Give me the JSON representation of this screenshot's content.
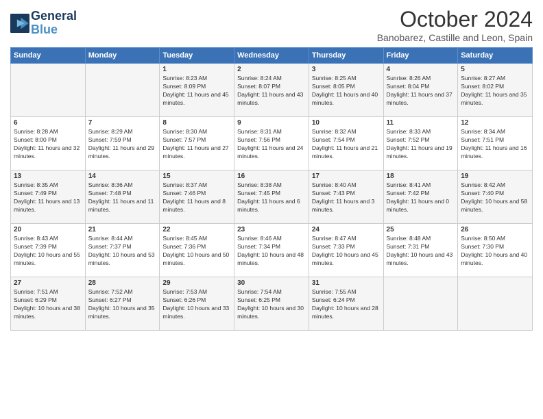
{
  "header": {
    "logo_line1": "General",
    "logo_line2": "Blue",
    "month": "October 2024",
    "location": "Banobarez, Castille and Leon, Spain"
  },
  "days_of_week": [
    "Sunday",
    "Monday",
    "Tuesday",
    "Wednesday",
    "Thursday",
    "Friday",
    "Saturday"
  ],
  "weeks": [
    [
      {
        "day": "",
        "content": ""
      },
      {
        "day": "",
        "content": ""
      },
      {
        "day": "1",
        "content": "Sunrise: 8:23 AM\nSunset: 8:09 PM\nDaylight: 11 hours and 45 minutes."
      },
      {
        "day": "2",
        "content": "Sunrise: 8:24 AM\nSunset: 8:07 PM\nDaylight: 11 hours and 43 minutes."
      },
      {
        "day": "3",
        "content": "Sunrise: 8:25 AM\nSunset: 8:05 PM\nDaylight: 11 hours and 40 minutes."
      },
      {
        "day": "4",
        "content": "Sunrise: 8:26 AM\nSunset: 8:04 PM\nDaylight: 11 hours and 37 minutes."
      },
      {
        "day": "5",
        "content": "Sunrise: 8:27 AM\nSunset: 8:02 PM\nDaylight: 11 hours and 35 minutes."
      }
    ],
    [
      {
        "day": "6",
        "content": "Sunrise: 8:28 AM\nSunset: 8:00 PM\nDaylight: 11 hours and 32 minutes."
      },
      {
        "day": "7",
        "content": "Sunrise: 8:29 AM\nSunset: 7:59 PM\nDaylight: 11 hours and 29 minutes."
      },
      {
        "day": "8",
        "content": "Sunrise: 8:30 AM\nSunset: 7:57 PM\nDaylight: 11 hours and 27 minutes."
      },
      {
        "day": "9",
        "content": "Sunrise: 8:31 AM\nSunset: 7:56 PM\nDaylight: 11 hours and 24 minutes."
      },
      {
        "day": "10",
        "content": "Sunrise: 8:32 AM\nSunset: 7:54 PM\nDaylight: 11 hours and 21 minutes."
      },
      {
        "day": "11",
        "content": "Sunrise: 8:33 AM\nSunset: 7:52 PM\nDaylight: 11 hours and 19 minutes."
      },
      {
        "day": "12",
        "content": "Sunrise: 8:34 AM\nSunset: 7:51 PM\nDaylight: 11 hours and 16 minutes."
      }
    ],
    [
      {
        "day": "13",
        "content": "Sunrise: 8:35 AM\nSunset: 7:49 PM\nDaylight: 11 hours and 13 minutes."
      },
      {
        "day": "14",
        "content": "Sunrise: 8:36 AM\nSunset: 7:48 PM\nDaylight: 11 hours and 11 minutes."
      },
      {
        "day": "15",
        "content": "Sunrise: 8:37 AM\nSunset: 7:46 PM\nDaylight: 11 hours and 8 minutes."
      },
      {
        "day": "16",
        "content": "Sunrise: 8:38 AM\nSunset: 7:45 PM\nDaylight: 11 hours and 6 minutes."
      },
      {
        "day": "17",
        "content": "Sunrise: 8:40 AM\nSunset: 7:43 PM\nDaylight: 11 hours and 3 minutes."
      },
      {
        "day": "18",
        "content": "Sunrise: 8:41 AM\nSunset: 7:42 PM\nDaylight: 11 hours and 0 minutes."
      },
      {
        "day": "19",
        "content": "Sunrise: 8:42 AM\nSunset: 7:40 PM\nDaylight: 10 hours and 58 minutes."
      }
    ],
    [
      {
        "day": "20",
        "content": "Sunrise: 8:43 AM\nSunset: 7:39 PM\nDaylight: 10 hours and 55 minutes."
      },
      {
        "day": "21",
        "content": "Sunrise: 8:44 AM\nSunset: 7:37 PM\nDaylight: 10 hours and 53 minutes."
      },
      {
        "day": "22",
        "content": "Sunrise: 8:45 AM\nSunset: 7:36 PM\nDaylight: 10 hours and 50 minutes."
      },
      {
        "day": "23",
        "content": "Sunrise: 8:46 AM\nSunset: 7:34 PM\nDaylight: 10 hours and 48 minutes."
      },
      {
        "day": "24",
        "content": "Sunrise: 8:47 AM\nSunset: 7:33 PM\nDaylight: 10 hours and 45 minutes."
      },
      {
        "day": "25",
        "content": "Sunrise: 8:48 AM\nSunset: 7:31 PM\nDaylight: 10 hours and 43 minutes."
      },
      {
        "day": "26",
        "content": "Sunrise: 8:50 AM\nSunset: 7:30 PM\nDaylight: 10 hours and 40 minutes."
      }
    ],
    [
      {
        "day": "27",
        "content": "Sunrise: 7:51 AM\nSunset: 6:29 PM\nDaylight: 10 hours and 38 minutes."
      },
      {
        "day": "28",
        "content": "Sunrise: 7:52 AM\nSunset: 6:27 PM\nDaylight: 10 hours and 35 minutes."
      },
      {
        "day": "29",
        "content": "Sunrise: 7:53 AM\nSunset: 6:26 PM\nDaylight: 10 hours and 33 minutes."
      },
      {
        "day": "30",
        "content": "Sunrise: 7:54 AM\nSunset: 6:25 PM\nDaylight: 10 hours and 30 minutes."
      },
      {
        "day": "31",
        "content": "Sunrise: 7:55 AM\nSunset: 6:24 PM\nDaylight: 10 hours and 28 minutes."
      },
      {
        "day": "",
        "content": ""
      },
      {
        "day": "",
        "content": ""
      }
    ]
  ]
}
